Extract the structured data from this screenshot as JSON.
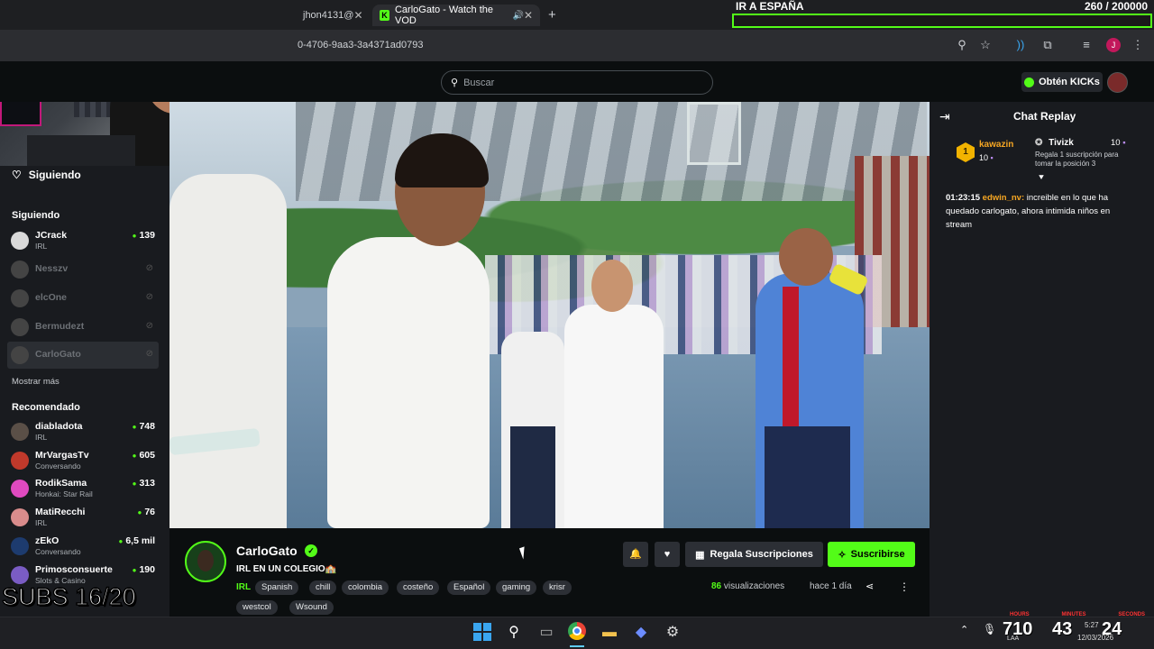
{
  "browser": {
    "tabs": [
      {
        "label": "jhon4131@",
        "close": "✕"
      },
      {
        "label": "CarloGato - Watch the VOD",
        "close": "✕"
      }
    ],
    "new_tab": "+",
    "url": "0-4706-9aa3-3a4371ad0793",
    "profile_initial": "J"
  },
  "goal": {
    "label": "IR A ESPAÑA",
    "count": "260 / 200000"
  },
  "header": {
    "search_placeholder": "Buscar",
    "get_kicks": "Obtén KICKs"
  },
  "sidebar": {
    "following_header": "Siguiendo",
    "following_section": "Siguiendo",
    "following": [
      {
        "name": "JCrack",
        "category": "IRL",
        "viewers": "139",
        "online": true
      },
      {
        "name": "Nesszv",
        "online": false
      },
      {
        "name": "elcOne",
        "online": false
      },
      {
        "name": "Bermudezt",
        "online": false
      },
      {
        "name": "CarloGato",
        "online": false
      }
    ],
    "show_more": "Mostrar más",
    "recommended_section": "Recomendado",
    "recommended": [
      {
        "name": "diabladota",
        "category": "IRL",
        "viewers": "748"
      },
      {
        "name": "MrVargasTv",
        "category": "Conversando",
        "viewers": "605"
      },
      {
        "name": "RodikSama",
        "category": "Honkai: Star Rail",
        "viewers": "313"
      },
      {
        "name": "MatiRecchi",
        "category": "IRL",
        "viewers": "76"
      },
      {
        "name": "zEkO",
        "category": "Conversando",
        "viewers": "6,5 mil"
      },
      {
        "name": "Primosconsuerte",
        "category": "Slots & Casino",
        "viewers": "190"
      }
    ]
  },
  "chat": {
    "title": "Chat Replay",
    "gift_banner": {
      "rank": "1",
      "user": "kawazin",
      "user_count": "10",
      "recipient_user": "Tivizk",
      "recipient_count": "10",
      "description": "Regala 1 suscripción para tomar la posición 3"
    },
    "messages": [
      {
        "time": "01:23:15",
        "user": "edwin_nv:",
        "text": "increible en lo que ha quedado carlogato, ahora intimida niños en stream"
      }
    ]
  },
  "channel": {
    "name": "CarloGato",
    "title": "IRL EN UN COLEGIO🏫",
    "category": "IRL",
    "tags": [
      "Spanish",
      "chill",
      "colombia",
      "costeño",
      "Español",
      "gaming",
      "krisr",
      "westcol",
      "Wsound"
    ],
    "gift_button": "Regala Suscripciones",
    "subscribe_button": "Suscribirse",
    "views_count": "86",
    "views_label": "visualizaciones",
    "ago": "hace 1 día"
  },
  "overlay": {
    "subs": "SUBS 16/20",
    "timer_labels": [
      "HOURS",
      "MINUTES",
      "SECONDS"
    ],
    "timer": [
      "710",
      "43",
      "24"
    ],
    "clock_time": "5:27",
    "clock_date": "12/03/2026",
    "lang": "LAA"
  },
  "colors": {
    "kick_green": "#53fc18",
    "background": "#0b0e0f",
    "panel": "#191b1f"
  }
}
